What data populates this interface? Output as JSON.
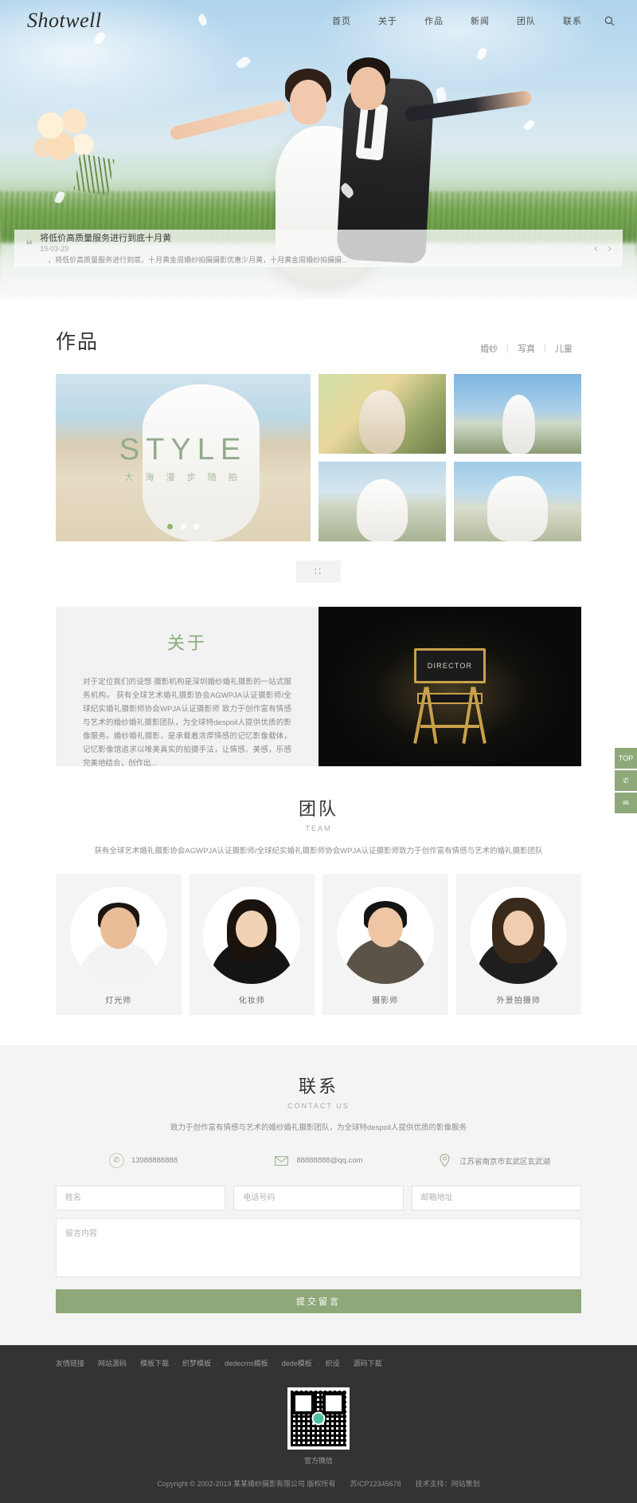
{
  "header": {
    "logo": "Shotwell",
    "nav": [
      {
        "label": "首页",
        "active": true
      },
      {
        "label": "关于",
        "active": false
      },
      {
        "label": "作品",
        "active": false
      },
      {
        "label": "新闻",
        "active": false
      },
      {
        "label": "团队",
        "active": false
      },
      {
        "label": "联系",
        "active": false
      }
    ],
    "search_icon": "search-icon"
  },
  "hero": {
    "news": {
      "quote_mark": "❝",
      "title": "将低价高质量服务进行到底十月黄",
      "date": "19-03-29",
      "desc": "，将低价高质量服务进行到底，十月黄金周婚纱拍摄摄影优惠少月黄，十月黄金周婚纱拍摄摄...",
      "prev": "‹",
      "next": "›"
    }
  },
  "works": {
    "title": "作品",
    "filters": [
      {
        "label": "婚纱",
        "active": false
      },
      {
        "label": "写真",
        "active": false
      },
      {
        "label": "儿童",
        "active": false
      }
    ],
    "featured": {
      "style_main": "STYLE",
      "style_sub": "大 海 漫 步 随 拍",
      "dots": 3,
      "active_dot": 1
    },
    "loadmore_label": "∷"
  },
  "about": {
    "title": "关于",
    "text": "对于定位我们的设想 摄影机构是深圳婚纱婚礼摄影的一站式服务机构。 获有全球艺术婚礼摄影协会AGWPJA认证摄影师/全球纪实婚礼摄影师协会WPJA认证摄影师 致力于创作富有情感与艺术的婚纱婚礼摄影团队，为全球特despoil人提供优质的影像服务。婚纱婚礼摄影，是承载着浓厚情感的记忆影像载体，记忆影像馆追求以唯美真实的拍摄手法，让情感、美感，乐感完美地结合，创作出...",
    "director_label": "DIRECTOR"
  },
  "team": {
    "title": "团队",
    "subtitle": "TEAM",
    "desc": "获有全球艺术婚礼摄影协会AGWPJA认证摄影师/全球纪实婚礼摄影师协会WPJA认证摄影师致力于创作富有情感与艺术的婚礼摄影团队",
    "members": [
      {
        "name": "灯光师"
      },
      {
        "name": "化妆师"
      },
      {
        "name": "摄影师"
      },
      {
        "name": "外景拍摄师"
      }
    ]
  },
  "contact": {
    "title": "联系",
    "subtitle": "CONTACT US",
    "desc": "致力于创作富有情感与艺术的婚纱婚礼摄影团队，为全球特despoil人提供优质的影像服务",
    "info": [
      {
        "icon": "phone-icon",
        "text": "13988888888"
      },
      {
        "icon": "mail-icon",
        "text": "88888888@qq.com"
      },
      {
        "icon": "location-icon",
        "text": "江苏省南京市玄武区玄武湖"
      }
    ],
    "form": {
      "name_placeholder": "姓名",
      "phone_placeholder": "电话号码",
      "email_placeholder": "邮箱地址",
      "message_placeholder": "留言内容",
      "submit_label": "提交留言"
    }
  },
  "footer": {
    "links": [
      "友情链接",
      "网站源码",
      "模板下载",
      "织梦模板",
      "dedecms模板",
      "dede模板",
      "织设",
      "源码下载"
    ],
    "qr_label": "官方微信",
    "copyright": "Copyright © 2002-2019 某某婚纱摄影有限公司 版权所有",
    "icp": "苏ICP12345678",
    "support_label": "技术支持：",
    "support_value": "网站策划"
  },
  "sidebar": {
    "items": [
      {
        "label": "TOP",
        "name": "back-to-top"
      },
      {
        "label": "✆",
        "name": "wechat-icon"
      },
      {
        "label": "✉",
        "name": "message-icon"
      }
    ]
  },
  "colors": {
    "accent": "#8fa87a",
    "about_green": "#8aab7a",
    "footer_bg": "#333333"
  }
}
